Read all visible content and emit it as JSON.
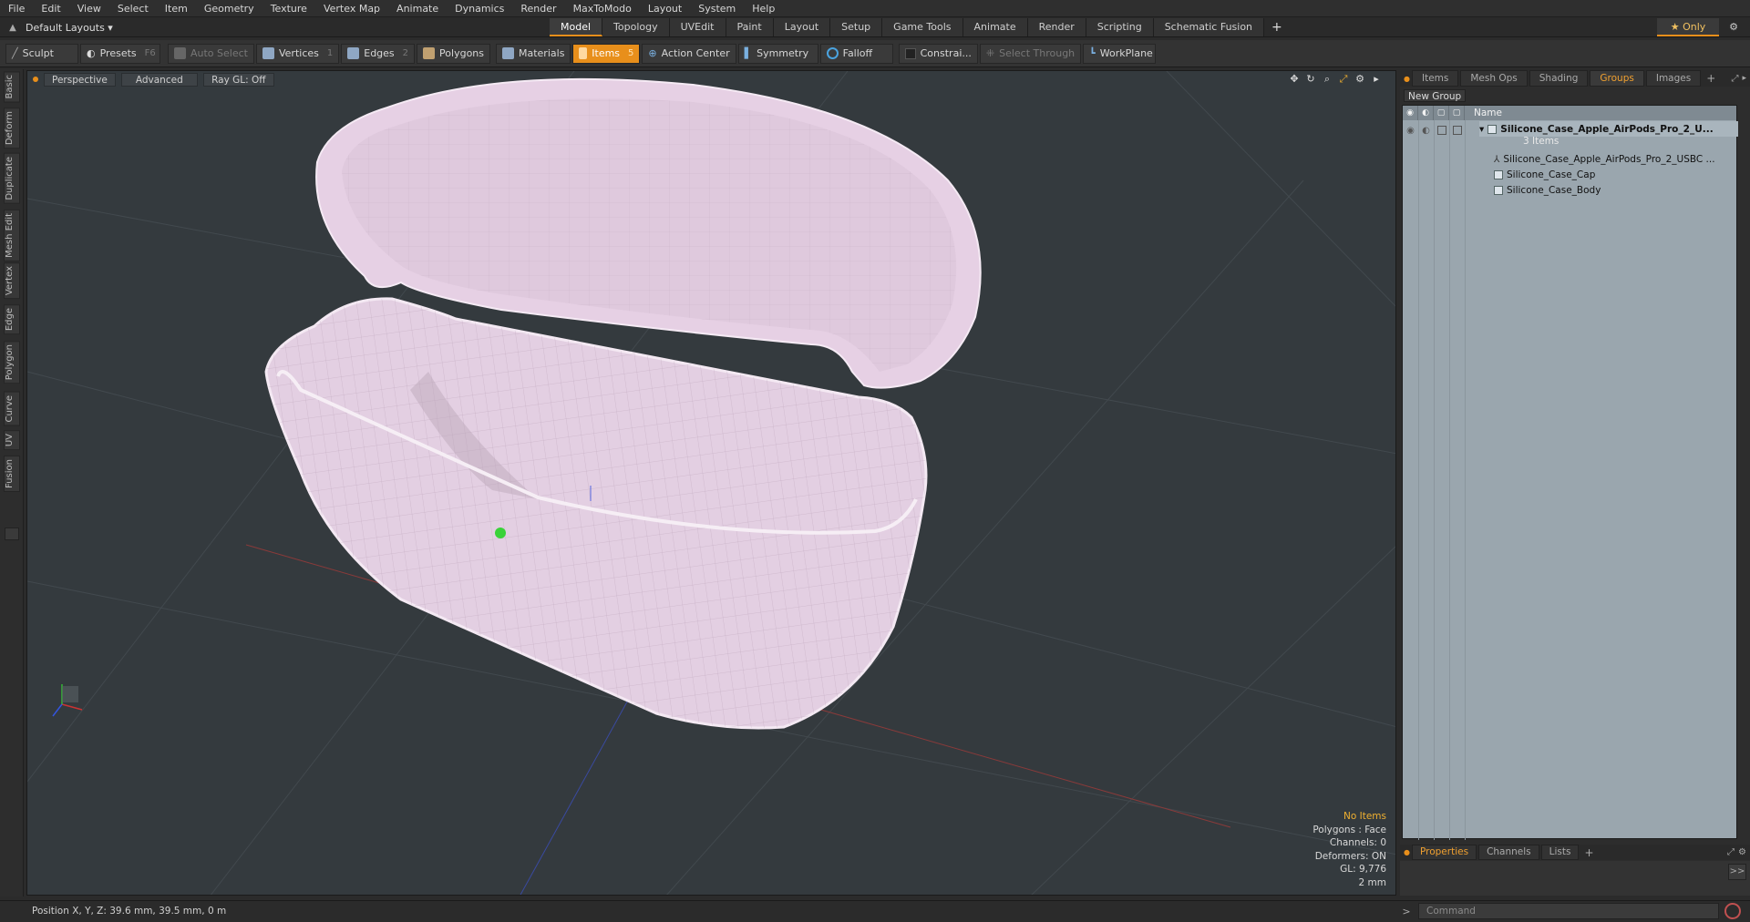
{
  "menu": [
    "File",
    "Edit",
    "View",
    "Select",
    "Item",
    "Geometry",
    "Texture",
    "Vertex Map",
    "Animate",
    "Dynamics",
    "Render",
    "MaxToModo",
    "Layout",
    "System",
    "Help"
  ],
  "layouts": {
    "label": "Default Layouts ▾"
  },
  "tabs": [
    "Model",
    "Topology",
    "UVEdit",
    "Paint",
    "Layout",
    "Setup",
    "Game Tools",
    "Animate",
    "Render",
    "Scripting",
    "Schematic Fusion"
  ],
  "active_tab": "Model",
  "only_label": "★  Only",
  "toolbar": {
    "sculpt": "Sculpt",
    "presets": "Presets",
    "presets_key": "F6",
    "auto_select": "Auto Select",
    "vertices": "Vertices",
    "vertices_key": "1",
    "edges": "Edges",
    "edges_key": "2",
    "polygons": "Polygons",
    "materials": "Materials",
    "items": "Items",
    "items_key": "5",
    "action_center": "Action Center",
    "symmetry": "Symmetry",
    "falloff": "Falloff",
    "constraints": "Constrai...",
    "select_through": "Select Through",
    "workplane": "WorkPlane"
  },
  "left_tabs": [
    "Basic",
    "Deform",
    "Duplicate",
    "Mesh Edit",
    "Vertex",
    "Edge",
    "Polygon",
    "Curve",
    "UV",
    "Fusion"
  ],
  "viewport": {
    "perspective": "Perspective",
    "advanced": "Advanced",
    "raygl": "Ray GL: Off",
    "info": {
      "no_items": "No Items",
      "polygons": "Polygons : Face",
      "channels": "Channels: 0",
      "deformers": "Deformers: ON",
      "gl": "GL: 9,776",
      "scale": "2 mm"
    },
    "colors": {
      "mesh": "#e8d3e6",
      "mesh_shade": "#c7b0c6",
      "bg": "#343a3e"
    }
  },
  "right_panel": {
    "tabs": [
      "Items",
      "Mesh Ops",
      "Shading",
      "Groups",
      "Images"
    ],
    "active_tab": "Groups",
    "new_group": "New Group",
    "name_header": "Name",
    "group_name": "Silicone_Case_Apple_AirPods_Pro_2_U...",
    "group_count": "3 Items",
    "children": [
      "Silicone_Case_Apple_AirPods_Pro_2_USBC ...",
      "Silicone_Case_Cap",
      "Silicone_Case_Body"
    ]
  },
  "bottom_tabs": [
    "Properties",
    "Channels",
    "Lists"
  ],
  "bottom_active": "Properties",
  "status": {
    "position": "Position X, Y, Z:   39.6 mm, 39.5 mm, 0 m"
  },
  "command": {
    "placeholder": "Command"
  }
}
